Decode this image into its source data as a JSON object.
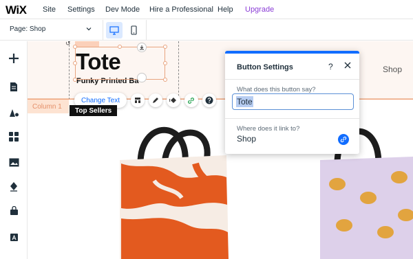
{
  "topbar": {
    "logo": "WiX",
    "menu": [
      "Site",
      "Settings",
      "Dev Mode",
      "Hire a Professional",
      "Help"
    ],
    "upgrade": "Upgrade"
  },
  "secondbar": {
    "page_label": "Page: Shop"
  },
  "canvas": {
    "column_label": "Column 1",
    "tote_title": "Tote",
    "tote_subtitle": "Funky Printed Ba",
    "shop_link": "Shop",
    "change_text": "Change Text",
    "top_sellers": "Top Sellers"
  },
  "panel": {
    "title": "Button Settings",
    "help": "?",
    "question1": "What does this button say?",
    "button_text_value": "Tote",
    "question2": "Where does it link to?",
    "link_value": "Shop"
  },
  "colors": {
    "accent": "#116dff",
    "upgrade": "#8a3cd6",
    "selection": "#e8a47f"
  }
}
